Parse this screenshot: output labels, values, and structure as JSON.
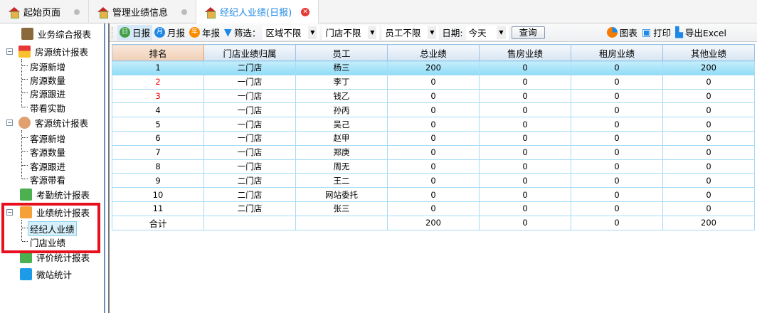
{
  "tabs": [
    {
      "label": "起始页面",
      "active": false
    },
    {
      "label": "管理业绩信息",
      "active": false
    },
    {
      "label": "经纪人业绩(日报)",
      "active": true
    }
  ],
  "sidebar": {
    "business_summary": "业务综合报表",
    "house": {
      "label": "房源统计报表",
      "children": [
        "房源新增",
        "房源数量",
        "房源跟进",
        "带看实勘"
      ]
    },
    "client": {
      "label": "客源统计报表",
      "children": [
        "客源新增",
        "客源数量",
        "客源跟进",
        "客源带看"
      ]
    },
    "attendance": "考勤统计报表",
    "performance": {
      "label": "业绩统计报表",
      "children": [
        "经纪人业绩",
        "门店业绩"
      ],
      "selected": "经纪人业绩"
    },
    "evaluation": "评价统计报表",
    "microsite": "微站统计"
  },
  "toolbar": {
    "daily": "日报",
    "daily_icon": "日",
    "monthly": "月报",
    "monthly_icon": "月",
    "yearly": "年报",
    "yearly_icon": "年",
    "filter": "筛选：",
    "area": "区域不限",
    "store": "门店不限",
    "staff": "员工不限",
    "date_label": "日期:",
    "date": "今天",
    "query": "查询",
    "chart": "图表",
    "print": "打印",
    "export": "导出Excel"
  },
  "table": {
    "headers": [
      "排名",
      "门店业绩归属",
      "员工",
      "总业绩",
      "售房业绩",
      "租房业绩",
      "其他业绩"
    ],
    "rows": [
      [
        "1",
        "二门店",
        "杨三",
        "200",
        "0",
        "0",
        "200"
      ],
      [
        "2",
        "一门店",
        "李丁",
        "0",
        "0",
        "0",
        "0"
      ],
      [
        "3",
        "一门店",
        "钱乙",
        "0",
        "0",
        "0",
        "0"
      ],
      [
        "4",
        "一门店",
        "孙丙",
        "0",
        "0",
        "0",
        "0"
      ],
      [
        "5",
        "一门店",
        "吴己",
        "0",
        "0",
        "0",
        "0"
      ],
      [
        "6",
        "一门店",
        "赵甲",
        "0",
        "0",
        "0",
        "0"
      ],
      [
        "7",
        "一门店",
        "郑庚",
        "0",
        "0",
        "0",
        "0"
      ],
      [
        "8",
        "一门店",
        "周无",
        "0",
        "0",
        "0",
        "0"
      ],
      [
        "9",
        "二门店",
        "王二",
        "0",
        "0",
        "0",
        "0"
      ],
      [
        "10",
        "二门店",
        "网站委托",
        "0",
        "0",
        "0",
        "0"
      ],
      [
        "11",
        "二门店",
        "张三",
        "0",
        "0",
        "0",
        "0"
      ]
    ],
    "total": [
      "合计",
      "",
      "",
      "200",
      "0",
      "0",
      "200"
    ]
  }
}
